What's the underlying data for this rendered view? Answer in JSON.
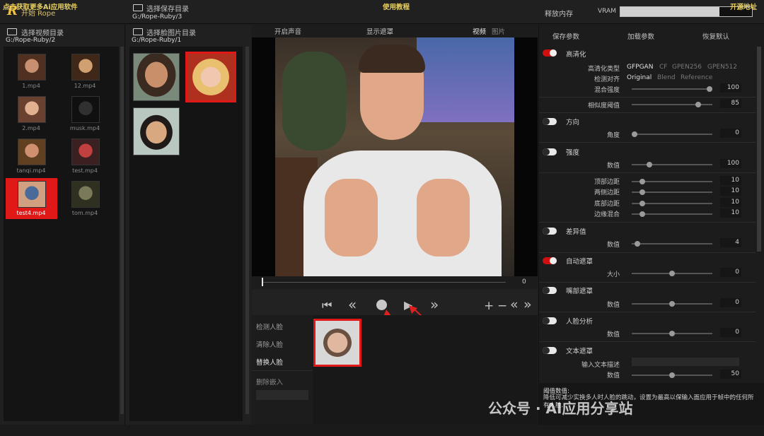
{
  "header": {
    "start_label": "开始 Rope",
    "logo_letter": "R",
    "save_dir_label": "选择保存目录",
    "save_dir_path": "G:/Rope-Ruby/3",
    "release_memory": "释放内存",
    "vram_label": "VRAM",
    "vram_usage": 0.75
  },
  "video_panel": {
    "select_label": "选择视频目录",
    "path": "G:/Rope-Ruby/2",
    "videos": [
      {
        "name": "1.mp4",
        "selected": false
      },
      {
        "name": "12.mp4",
        "selected": false
      },
      {
        "name": "2.mp4",
        "selected": false
      },
      {
        "name": "musk.mp4",
        "selected": false
      },
      {
        "name": "tanqi.mp4",
        "selected": false
      },
      {
        "name": "test.mp4",
        "selected": false
      },
      {
        "name": "test4.mp4",
        "selected": true
      },
      {
        "name": "tom.mp4",
        "selected": false
      }
    ]
  },
  "face_panel": {
    "select_label": "选择脸图片目录",
    "path": "G:/Rope-Ruby/1",
    "faces": [
      {
        "id": "face-1",
        "selected": false
      },
      {
        "id": "face-2",
        "selected": true
      },
      {
        "id": "face-3",
        "selected": false
      }
    ]
  },
  "viewer": {
    "toolbar": {
      "audio": "开启声音",
      "show_mask": "显示遮罩",
      "video_tab": "视频",
      "image_tab": "图片"
    },
    "frame_value": "0"
  },
  "controls": {
    "icons": [
      "skip-start-icon",
      "rewind-icon",
      "record-icon",
      "play-icon",
      "fast-forward-icon"
    ],
    "right_icons": [
      "+",
      "−",
      "«",
      "»"
    ]
  },
  "detect_panel": {
    "detect_face": "检测人脸",
    "clear_face": "清除人脸",
    "swap_face": "替换人脸",
    "delete_embed": "删除嵌入"
  },
  "params": {
    "save": "保存参数",
    "load": "加载参数",
    "reset": "恢复默认",
    "hd": {
      "label": "高清化",
      "on": true,
      "type_label": "高清化类型",
      "types": [
        "GFPGAN",
        "CF",
        "GPEN256",
        "GPEN512"
      ],
      "align_label": "检测对齐",
      "aligns": [
        "Original",
        "Blend",
        "Reference"
      ],
      "blend_label": "混合强度",
      "blend_value": 100,
      "sim_label": "相似度阈值",
      "sim_value": 85
    },
    "direction": {
      "label": "方向",
      "on": false,
      "angle_label": "角度",
      "angle_value": 0
    },
    "strength": {
      "label": "强度",
      "on": false,
      "value_label": "数值",
      "value": 100,
      "top_label": "顶部边距",
      "top_value": 10,
      "side_label": "两侧边距",
      "side_value": 10,
      "bottom_label": "底部边距",
      "bottom_value": 10,
      "edge_label": "边缘混合",
      "edge_value": 10
    },
    "diff": {
      "label": "差异值",
      "on": false,
      "value_label": "数值",
      "value": 4
    },
    "auto_mask": {
      "label": "自动遮罩",
      "on": true,
      "size_label": "大小",
      "value": 0
    },
    "mouth_mask": {
      "label": "嘴部遮罩",
      "on": false,
      "value_label": "数值",
      "value": 0
    },
    "face_parse": {
      "label": "人脸分析",
      "on": false,
      "value_label": "数值",
      "value": 0
    },
    "text_mask": {
      "label": "文本遮罩",
      "on": false,
      "desc_label": "输入文本描述",
      "value_label": "数值",
      "value": 50
    },
    "tooltip_title": "阈值数值:",
    "tooltip_text": "降低可减少实换多人时人脸的跳动，设置为最高以保输入面应用于帧中的任何所有人脸."
  },
  "footer": {
    "left": "点击获取更多Ai应用软件",
    "middle": "使用教程",
    "right": "开源地址"
  },
  "watermark": "公众号 · AI应用分享站"
}
